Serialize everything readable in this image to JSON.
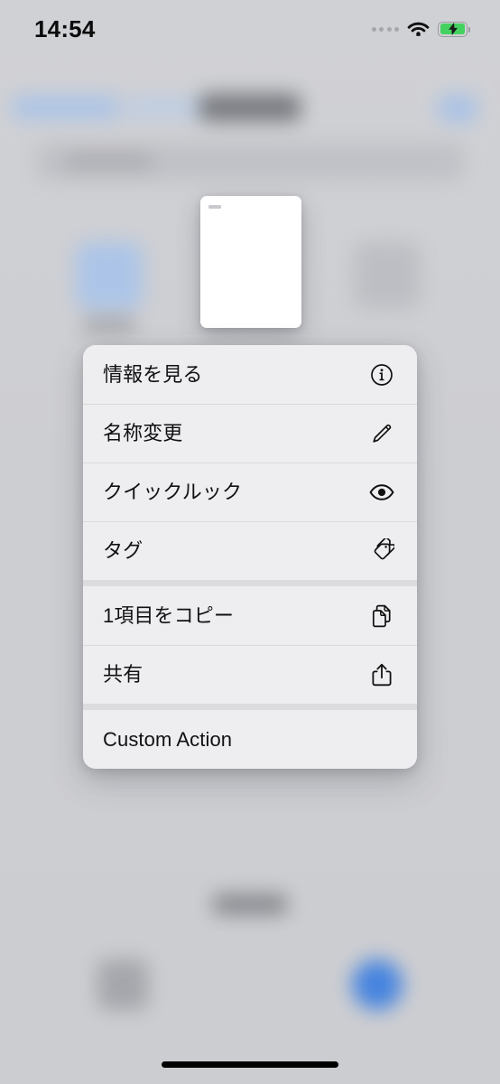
{
  "status_bar": {
    "time": "14:54",
    "signal_icon": "signal-dots-icon",
    "wifi_icon": "wifi-icon",
    "battery_icon": "battery-charging-icon",
    "battery_color": "#45d15f"
  },
  "preview": {
    "name": "document-preview-thumbnail",
    "kind": "blank-document"
  },
  "context_menu": {
    "groups": [
      {
        "items": [
          {
            "label": "情報を見る",
            "icon": "info-circle-icon",
            "name": "menu-item-get-info"
          },
          {
            "label": "名称変更",
            "icon": "pencil-icon",
            "name": "menu-item-rename"
          },
          {
            "label": "クイックルック",
            "icon": "eye-icon",
            "name": "menu-item-quick-look"
          },
          {
            "label": "タグ",
            "icon": "tag-icon",
            "name": "menu-item-tags"
          }
        ]
      },
      {
        "items": [
          {
            "label": "1項目をコピー",
            "icon": "copy-documents-icon",
            "name": "menu-item-copy"
          },
          {
            "label": "共有",
            "icon": "share-icon",
            "name": "menu-item-share"
          }
        ]
      },
      {
        "items": [
          {
            "label": "Custom Action",
            "icon": "",
            "name": "menu-item-custom-action"
          }
        ]
      }
    ]
  },
  "background_app": {
    "blurred": true,
    "accent_color": "#3b7ee0",
    "surface_color": "#cdced2"
  },
  "home_indicator": {
    "name": "home-indicator"
  }
}
